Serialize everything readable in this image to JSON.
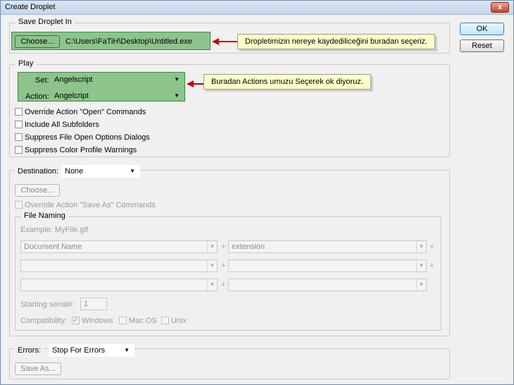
{
  "window": {
    "title": "Create Droplet",
    "close": "x"
  },
  "buttons": {
    "ok": "OK",
    "reset": "Reset"
  },
  "save_in": {
    "legend": "Save Droplet In",
    "choose": "Choose...",
    "path": "C:\\Users\\FaTiH\\Desktop\\Untitled.exe",
    "callout": "Dropletimizin nereye kaydediliceğini buradan seçeriz."
  },
  "play": {
    "legend": "Play",
    "set_label": "Set:",
    "set_value": "Angelscript",
    "action_label": "Action:",
    "action_value": "Angelcript",
    "callout": "Buradan Actions umuzu Seçerek ok diyoruz.",
    "options": [
      "Override Action \"Open\" Commands",
      "Include All Subfolders",
      "Suppress File Open Options Dialogs",
      "Suppress Color Profile Warnings"
    ]
  },
  "destination": {
    "label": "Destination:",
    "value": "None",
    "choose": "Choose...",
    "override": "Override Action \"Save As\" Commands",
    "file_naming": {
      "legend": "File Naming",
      "example": "Example: MyFile.gif",
      "row1_left": "Document Name",
      "row1_right": "extension",
      "plus": "+",
      "serial_label": "Starting serial#:",
      "serial_value": "1",
      "compat_label": "Compatibility:",
      "compat_windows": "Windows",
      "compat_mac": "Mac OS",
      "compat_unix": "Unix"
    }
  },
  "errors": {
    "label": "Errors:",
    "value": "Stop For Errors",
    "save_as": "Save As..."
  },
  "colors": {
    "highlight_green": "#8cc48c",
    "callout_yellow": "#ffffc8",
    "arrow_red": "#cc0000"
  }
}
